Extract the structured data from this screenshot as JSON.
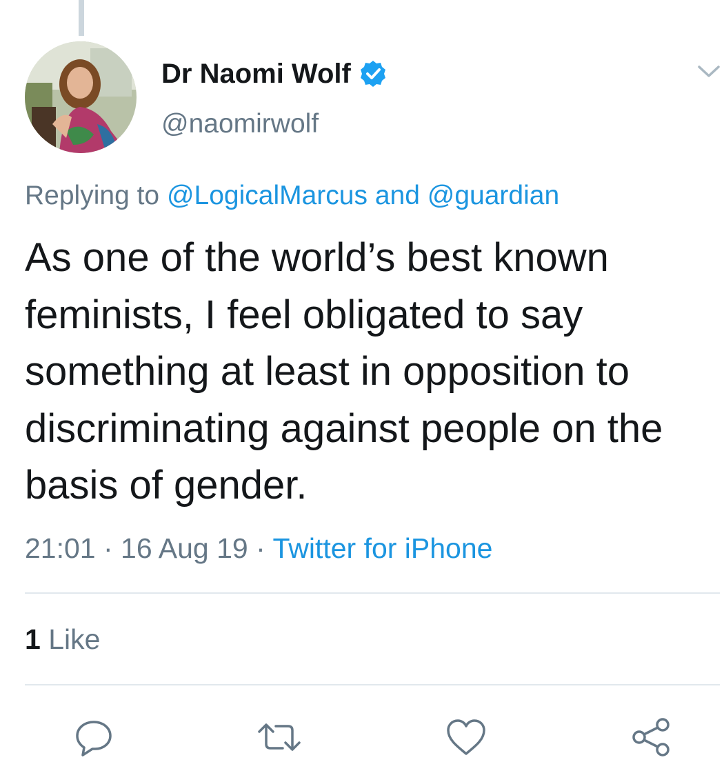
{
  "author": {
    "display_name": "Dr Naomi Wolf",
    "handle": "@naomirwolf",
    "verified": true,
    "avatar_icon": "profile-photo"
  },
  "reply": {
    "prefix": "Replying to ",
    "to_1": "@LogicalMarcus",
    "connector": " and ",
    "to_2": "@guardian"
  },
  "tweet": {
    "text": "As one of the world’s best known feminists, I feel obligated to say something at least in opposition to discriminating against people on the basis of gender."
  },
  "meta": {
    "time": "21:01",
    "sep1": " · ",
    "date": "16 Aug 19",
    "sep2": " · ",
    "source": "Twitter for iPhone"
  },
  "stats": {
    "likes_count": "1",
    "likes_label": " Like"
  },
  "actions": [
    {
      "icon": "reply-icon"
    },
    {
      "icon": "retweet-icon"
    },
    {
      "icon": "like-icon"
    },
    {
      "icon": "share-icon"
    }
  ],
  "colors": {
    "link": "#1b95e0",
    "secondary_text": "#657786",
    "primary_text": "#14171a",
    "divider": "#e1e8ed",
    "verified_badge": "#1da1f2"
  }
}
